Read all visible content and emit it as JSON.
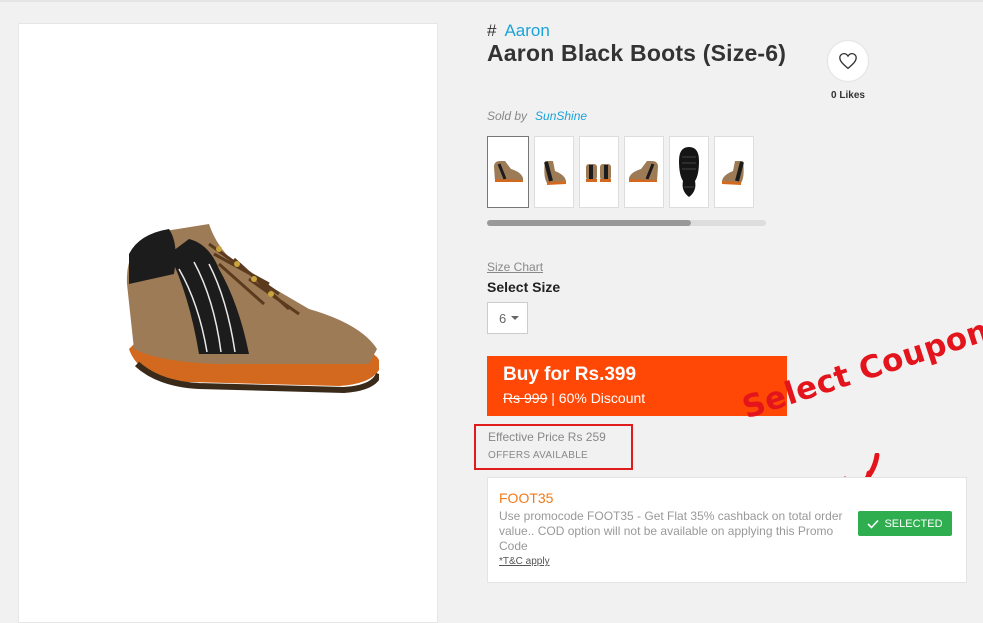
{
  "brand": {
    "hash": "#",
    "name": "Aaron"
  },
  "product": {
    "title": "Aaron Black Boots (Size-6)"
  },
  "likes": {
    "count_label": "0 Likes"
  },
  "seller": {
    "prefix": "Sold by",
    "name": "SunShine"
  },
  "gallery": {
    "thumbnails": 6,
    "scroll_fraction": 0.73
  },
  "size": {
    "chart_link": "Size Chart",
    "heading": "Select Size",
    "selected": "6"
  },
  "buy": {
    "label": "Buy for Rs.399",
    "original_price": "Rs 999",
    "separator": "|",
    "discount": "60% Discount"
  },
  "effective": {
    "price": "Effective Price Rs 259",
    "offers": "OFFERS AVAILABLE"
  },
  "annotation": {
    "text": "Select Coupon"
  },
  "coupon": {
    "code": "FOOT35",
    "description": "Use promocode FOOT35 - Get Flat 35% cashback on total order value.. COD option will not be available on applying this Promo Code",
    "tnc": "*T&C apply",
    "status": "SELECTED"
  },
  "colors": {
    "accent": "#1aa3d9",
    "buy_button": "#ff4805",
    "selected_button": "#2fae4f",
    "highlight_red": "#e01b1b",
    "coupon_code": "#f07b1b"
  },
  "icons": {
    "like": "heart-icon",
    "size_dropdown": "caret-down-icon",
    "selected": "checkmark-icon",
    "annotation_arrow": "red-arrow-icon"
  }
}
